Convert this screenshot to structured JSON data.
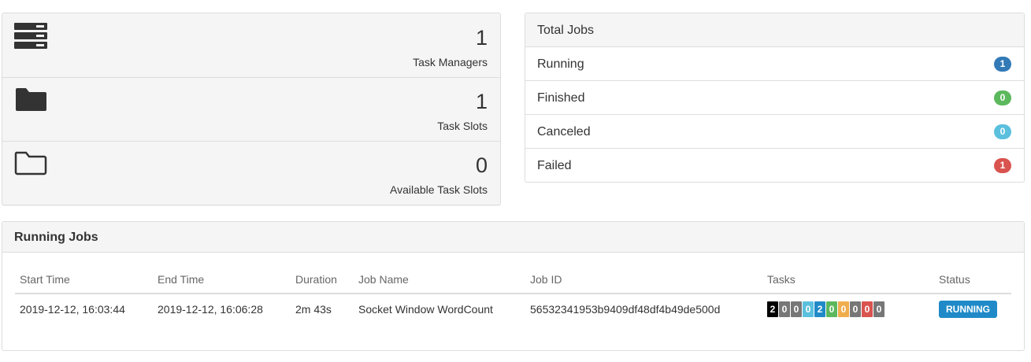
{
  "stats": {
    "task_managers": {
      "value": "1",
      "label": "Task Managers",
      "icon": "server-icon"
    },
    "task_slots": {
      "value": "1",
      "label": "Task Slots",
      "icon": "folder-filled-icon"
    },
    "available_task_slots": {
      "value": "0",
      "label": "Available Task Slots",
      "icon": "folder-open-icon"
    }
  },
  "total_jobs": {
    "title": "Total Jobs",
    "rows": [
      {
        "label": "Running",
        "count": "1",
        "color": "#337ab7"
      },
      {
        "label": "Finished",
        "count": "0",
        "color": "#5cb85c"
      },
      {
        "label": "Canceled",
        "count": "0",
        "color": "#5bc0de"
      },
      {
        "label": "Failed",
        "count": "1",
        "color": "#d9534f"
      }
    ]
  },
  "running_jobs": {
    "title": "Running Jobs",
    "columns": [
      "Start Time",
      "End Time",
      "Duration",
      "Job Name",
      "Job ID",
      "Tasks",
      "Status"
    ],
    "rows": [
      {
        "start_time": "2019-12-12, 16:03:44",
        "end_time": "2019-12-12, 16:06:28",
        "duration": "2m 43s",
        "job_name": "Socket Window WordCount",
        "job_id": "56532341953b9409df48df4b49de500d",
        "tasks": [
          {
            "value": "2",
            "color": "#000000"
          },
          {
            "value": "0",
            "color": "#777777"
          },
          {
            "value": "0",
            "color": "#777777"
          },
          {
            "value": "0",
            "color": "#5bc0de"
          },
          {
            "value": "2",
            "color": "#1f8ac7"
          },
          {
            "value": "0",
            "color": "#5cb85c"
          },
          {
            "value": "0",
            "color": "#f0ad4e"
          },
          {
            "value": "0",
            "color": "#777777"
          },
          {
            "value": "0",
            "color": "#d9534f"
          },
          {
            "value": "0",
            "color": "#777777"
          }
        ],
        "status": "RUNNING",
        "status_color": "#1f8ac7"
      }
    ]
  }
}
